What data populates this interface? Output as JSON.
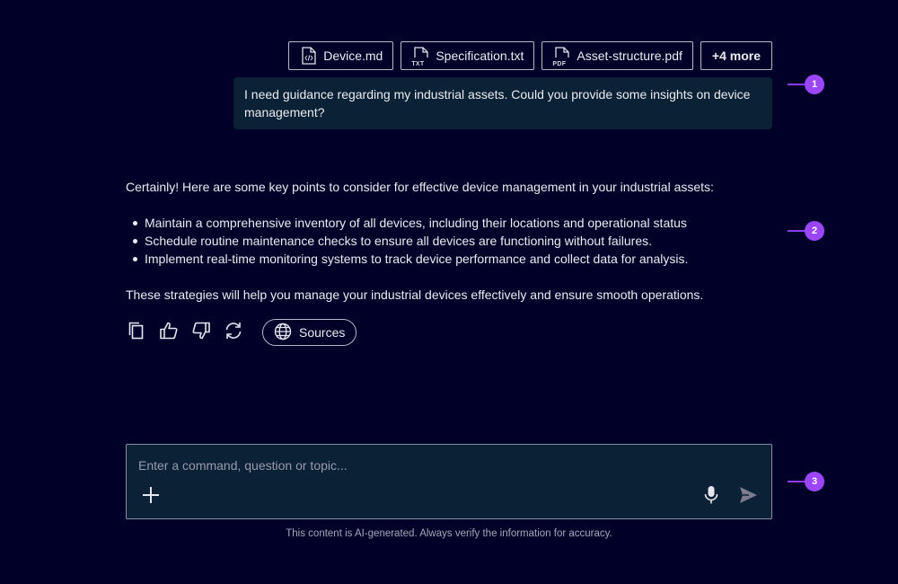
{
  "attachments": [
    {
      "name": "Device.md",
      "type_label": ""
    },
    {
      "name": "Specification.txt",
      "type_label": "TXT"
    },
    {
      "name": "Asset-structure.pdf",
      "type_label": "PDF"
    }
  ],
  "more_attachments_label": "+4 more",
  "user_message": "I need guidance regarding my industrial assets. Could you provide some insights on device management?",
  "response": {
    "intro": "Certainly! Here are some key points to consider for effective device management in your industrial assets:",
    "bullets": [
      "Maintain a comprehensive inventory of all devices, including their locations and operational status",
      "Schedule routine maintenance checks to ensure all devices are functioning without failures.",
      "Implement real-time monitoring systems to track device performance and collect data for analysis."
    ],
    "outro": "These strategies will help you manage your industrial devices effectively and ensure smooth operations."
  },
  "actions": {
    "icons": [
      "copy-icon",
      "thumbs-up-icon",
      "thumbs-down-icon",
      "regenerate-icon"
    ],
    "sources_label": "Sources",
    "sources_icon": "globe-icon"
  },
  "markers": [
    "1",
    "2",
    "3"
  ],
  "composer": {
    "placeholder": "Enter a command, question or topic...",
    "value": ""
  },
  "disclaimer": "This content is AI-generated. Always verify the information for accuracy.",
  "colors": {
    "background": "#000028",
    "surface": "#0a2136",
    "accent": "#9b45ff",
    "text": "#ebebf0"
  }
}
